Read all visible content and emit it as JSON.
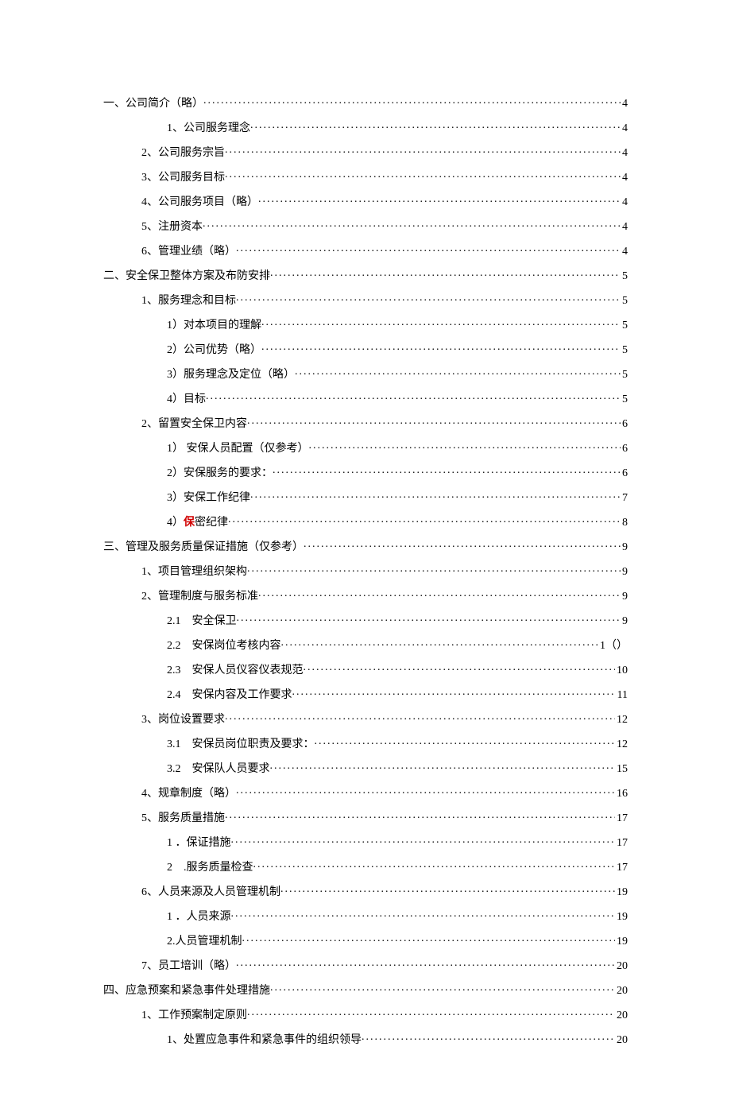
{
  "toc": [
    {
      "indent": "indent-0",
      "label": "一、公司简介（略）",
      "page": "4"
    },
    {
      "indent": "indent-1b",
      "label": "1、公司服务理念",
      "page": "4"
    },
    {
      "indent": "indent-1",
      "label": "2、公司服务宗旨",
      "page": "4"
    },
    {
      "indent": "indent-1",
      "label": "3、公司服务目标",
      "page": "4"
    },
    {
      "indent": "indent-1",
      "label": "4、公司服务项目（略）",
      "page": "4"
    },
    {
      "indent": "indent-1",
      "label": "5、注册资本",
      "page": "4"
    },
    {
      "indent": "indent-1",
      "label": "6、管理业绩（略）",
      "page": "4"
    },
    {
      "indent": "indent-0",
      "label": "二、安全保卫整体方案及布防安排",
      "page": "5"
    },
    {
      "indent": "indent-1",
      "label": "1、服务理念和目标",
      "page": "5"
    },
    {
      "indent": "indent-2",
      "label": "1）对本项目的理解",
      "page": "5"
    },
    {
      "indent": "indent-2",
      "label": "2）公司优势（略）",
      "page": "5"
    },
    {
      "indent": "indent-2",
      "label": "3）服务理念及定位（略）",
      "page": "5"
    },
    {
      "indent": "indent-2",
      "label": "4）目标",
      "page": "5"
    },
    {
      "indent": "indent-1",
      "label": "2、留置安全保卫内容",
      "page": "6"
    },
    {
      "indent": "indent-2",
      "label": "1） 安保人员配置（仅参考）",
      "page": "6"
    },
    {
      "indent": "indent-2",
      "label": "2）安保服务的要求：",
      "page": "6"
    },
    {
      "indent": "indent-2",
      "label": "3）安保工作纪律",
      "page": "7"
    },
    {
      "indent": "indent-2",
      "label_pre": "4）",
      "label_hl": "保",
      "label_post": "密纪律",
      "page": "8"
    },
    {
      "indent": "indent-0",
      "label": "三、管理及服务质量保证措施（仅参考）",
      "page": "9"
    },
    {
      "indent": "indent-1",
      "label": "1、项目管理组织架构",
      "page": "9"
    },
    {
      "indent": "indent-1",
      "label": "2、管理制度与服务标准",
      "page": "9"
    },
    {
      "indent": "indent-2",
      "label": "2.1　安全保卫",
      "page": "9"
    },
    {
      "indent": "indent-2",
      "label": "2.2　安保岗位考核内容",
      "page": "1（）"
    },
    {
      "indent": "indent-2",
      "label": "2.3　安保人员仪容仪表规范",
      "page": "10"
    },
    {
      "indent": "indent-2",
      "label": "2.4　安保内容及工作要求",
      "page": "11"
    },
    {
      "indent": "indent-1",
      "label": "3、岗位设置要求",
      "page": "12"
    },
    {
      "indent": "indent-2",
      "label": "3.1　安保员岗位职责及要求：",
      "page": "12"
    },
    {
      "indent": "indent-2",
      "label": "3.2　安保队人员要求",
      "page": "15"
    },
    {
      "indent": "indent-1",
      "label": "4、规章制度（略）",
      "page": "16"
    },
    {
      "indent": "indent-1",
      "label": "5、服务质量措施",
      "page": "17"
    },
    {
      "indent": "indent-2",
      "label": "1 ．保证措施",
      "page": "17"
    },
    {
      "indent": "indent-2",
      "label": "2　.服务质量检查",
      "page": "17"
    },
    {
      "indent": "indent-1",
      "label": "6、人员来源及人员管理机制",
      "page": "19"
    },
    {
      "indent": "indent-2",
      "label": "1 ．人员来源",
      "page": "19"
    },
    {
      "indent": "indent-2",
      "label": "2.人员管理机制",
      "page": "19"
    },
    {
      "indent": "indent-1",
      "label": "7、员工培训（略）",
      "page": "20"
    },
    {
      "indent": "indent-0",
      "label": "四、应急预案和紧急事件处理措施",
      "page": "20"
    },
    {
      "indent": "indent-1",
      "label": "1、工作预案制定原则",
      "page": "20"
    },
    {
      "indent": "indent-2",
      "label": "1、处置应急事件和紧急事件的组织领导",
      "page": "20"
    }
  ]
}
